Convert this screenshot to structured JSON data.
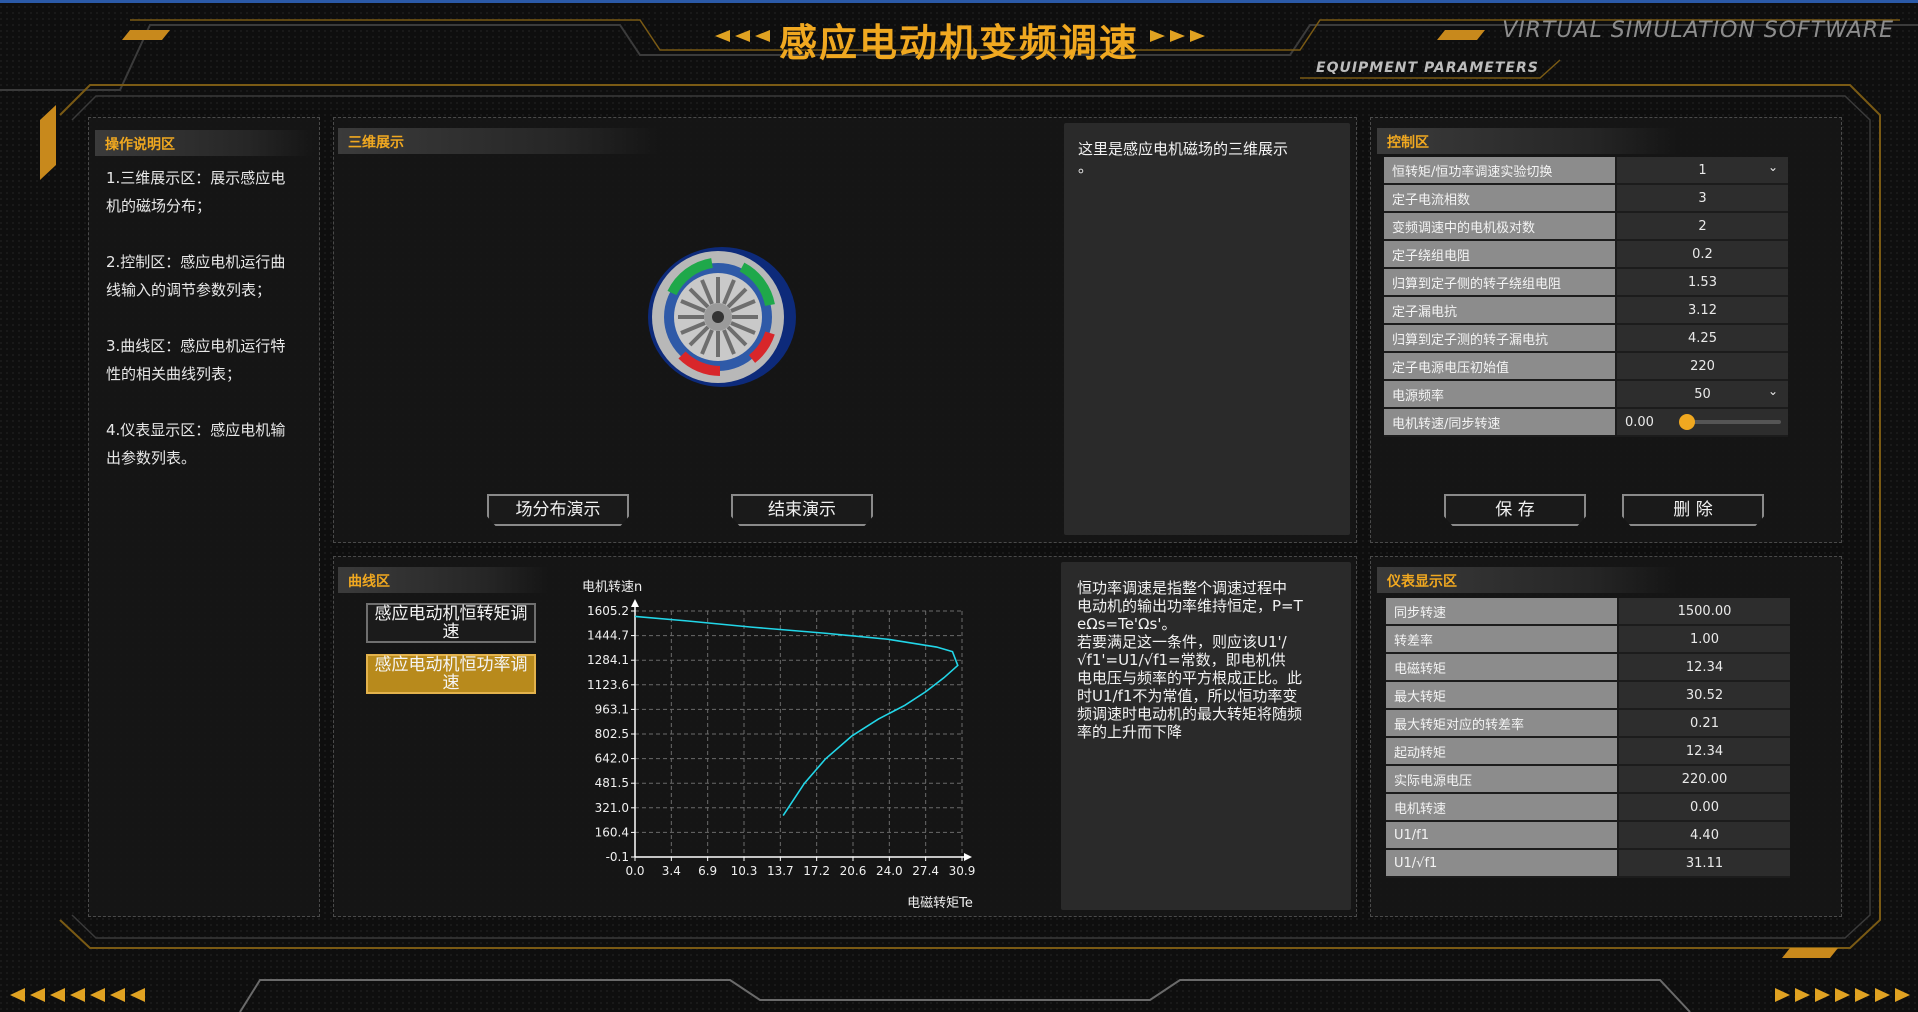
{
  "header": {
    "title": "感应电动机变频调速",
    "software": "VIRTUAL SIMULATION SOFTWARE",
    "subtitle": "EQUIPMENT PARAMETERS"
  },
  "instructions": {
    "title": "操作说明区",
    "items": [
      "1.三维展示区：展示感应电\n机的磁场分布；",
      "2.控制区：感应电机运行曲\n线输入的调节参数列表；",
      "3.曲线区：感应电机运行特\n性的相关曲线列表；",
      "4.仪表显示区：感应电机输\n出参数列表。"
    ]
  },
  "view3d": {
    "title": "三维展示",
    "start_button": "场分布演示",
    "stop_button": "结束演示",
    "description": "   这里是感应电机磁场的三维展示\n。"
  },
  "control": {
    "title": "控制区",
    "rows": [
      {
        "label": "恒转矩/恒功率调速实验切换",
        "value": "1"
      },
      {
        "label": "定子电流相数",
        "value": "3"
      },
      {
        "label": "变频调速中的电机极对数",
        "value": "2"
      },
      {
        "label": "定子绕组电阻",
        "value": "0.2"
      },
      {
        "label": "归算到定子侧的转子绕组电阻",
        "value": "1.53"
      },
      {
        "label": "定子漏电抗",
        "value": "3.12"
      },
      {
        "label": "归算到定子测的转子漏电抗",
        "value": "4.25"
      },
      {
        "label": "定子电源电压初始值",
        "value": "220"
      },
      {
        "label": "电源频率",
        "value": "50"
      },
      {
        "label": "电机转速/同步转速",
        "value": "0.00"
      }
    ],
    "slider_fraction": 0,
    "save_button": "保 存",
    "delete_button": "删 除"
  },
  "curve": {
    "title": "曲线区",
    "tab_torque": "感应电动机恒转矩调速",
    "tab_power": "感应电动机恒功率调速",
    "description": "   恒功率调速是指整个调速过程中\n电动机的输出功率维持恒定，P=T\neΩs=Te'Ωs'。\n   若要满足这一条件，则应该U1'/\n√f1'=U1/√f1=常数，即电机供\n电电压与频率的平方根成正比。此\n时U1/f1不为常值，所以恒功率变\n频调速时电动机的最大转矩将随频\n率的上升而下降"
  },
  "chart_data": {
    "type": "line",
    "xlabel": "电磁转矩Te",
    "ylabel": "电机转速n",
    "xlim": [
      0.0,
      30.9
    ],
    "ylim": [
      -0.1,
      1605.2
    ],
    "xticks": [
      "0.0",
      "3.4",
      "6.9",
      "10.3",
      "13.7",
      "17.2",
      "20.6",
      "24.0",
      "27.4",
      "30.9"
    ],
    "yticks": [
      "-0.1",
      "160.4",
      "321.0",
      "481.5",
      "642.0",
      "802.5",
      "963.1",
      "1123.6",
      "1284.1",
      "1444.7",
      "1605.2"
    ],
    "grid": true,
    "color": "#22d6e8",
    "series": [
      {
        "x": [
          14.0,
          16.0,
          18.0,
          20.5,
          23.0,
          25.5,
          27.5,
          29.2,
          30.5,
          30.0,
          28.5,
          24.0,
          18.0,
          11.0,
          5.0,
          0.0
        ],
        "y": [
          270,
          480,
          640,
          790,
          900,
          990,
          1080,
          1170,
          1250,
          1340,
          1370,
          1420,
          1460,
          1500,
          1540,
          1570
        ]
      }
    ]
  },
  "meter": {
    "title": "仪表显示区",
    "rows": [
      {
        "label": "同步转速",
        "value": "1500.00"
      },
      {
        "label": "转差率",
        "value": "1.00"
      },
      {
        "label": "电磁转矩",
        "value": "12.34"
      },
      {
        "label": "最大转矩",
        "value": "30.52"
      },
      {
        "label": "最大转矩对应的转差率",
        "value": "0.21"
      },
      {
        "label": "起动转矩",
        "value": "12.34"
      },
      {
        "label": "实际电源电压",
        "value": "220.00"
      },
      {
        "label": "电机转速",
        "value": "0.00"
      },
      {
        "label": "U1/f1",
        "value": "4.40"
      },
      {
        "label": "U1/√f1",
        "value": "31.11"
      }
    ]
  }
}
